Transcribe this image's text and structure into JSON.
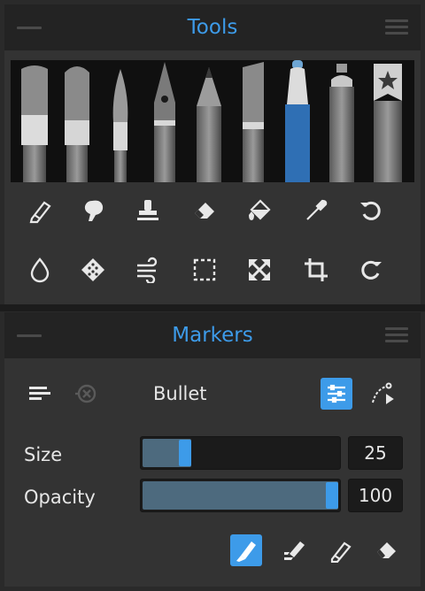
{
  "tools_panel": {
    "title": "Tools"
  },
  "brushes": [
    {
      "name": "brush-1-icon"
    },
    {
      "name": "brush-2-icon"
    },
    {
      "name": "brush-3-icon"
    },
    {
      "name": "pen-nib-icon"
    },
    {
      "name": "pencil-icon"
    },
    {
      "name": "marker-icon"
    },
    {
      "name": "blue-marker-icon"
    },
    {
      "name": "spray-can-icon"
    },
    {
      "name": "favorites-icon"
    }
  ],
  "tool_rows": {
    "row1": [
      "eraser-brush-icon",
      "smudge-icon",
      "stamp-icon",
      "eraser-icon",
      "fill-bucket-icon",
      "eyedropper-icon",
      "undo-icon"
    ],
    "row2": [
      "blur-drop-icon",
      "texture-icon",
      "wind-icon",
      "selection-icon",
      "transform-icon",
      "crop-icon",
      "redo-icon"
    ]
  },
  "markers_panel": {
    "title": "Markers",
    "preset_name": "Bullet",
    "size_label": "Size",
    "size_value": "25",
    "size_fraction": 0.25,
    "opacity_label": "Opacity",
    "opacity_value": "100",
    "opacity_fraction": 1.0
  },
  "colors": {
    "accent": "#3d9be9",
    "panel": "#333333",
    "header": "#232323"
  }
}
